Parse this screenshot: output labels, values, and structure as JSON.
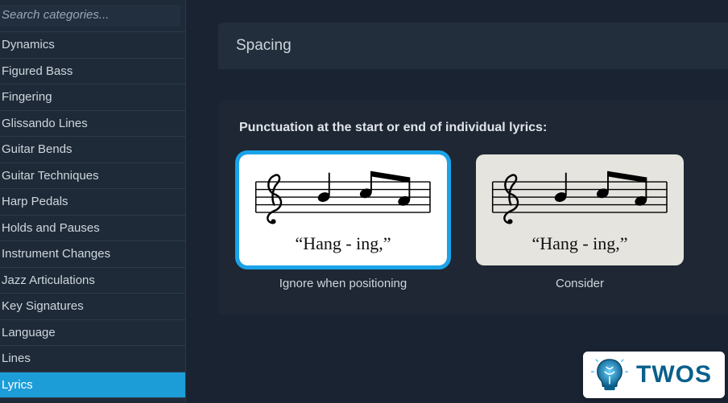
{
  "sidebar": {
    "search_placeholder": "Search categories...",
    "items": [
      {
        "label": "Dynamics",
        "selected": false
      },
      {
        "label": "Figured Bass",
        "selected": false
      },
      {
        "label": "Fingering",
        "selected": false
      },
      {
        "label": "Glissando Lines",
        "selected": false
      },
      {
        "label": "Guitar Bends",
        "selected": false
      },
      {
        "label": "Guitar Techniques",
        "selected": false
      },
      {
        "label": "Harp Pedals",
        "selected": false
      },
      {
        "label": "Holds and Pauses",
        "selected": false
      },
      {
        "label": "Instrument Changes",
        "selected": false
      },
      {
        "label": "Jazz Articulations",
        "selected": false
      },
      {
        "label": "Key Signatures",
        "selected": false
      },
      {
        "label": "Language",
        "selected": false
      },
      {
        "label": "Lines",
        "selected": false
      },
      {
        "label": "Lyrics",
        "selected": true
      }
    ]
  },
  "main": {
    "section_title": "Spacing",
    "setting_label": "Punctuation at the start or end of individual lyrics:",
    "options": [
      {
        "selected": true,
        "caption": "Ignore when positioning",
        "lyric": "“Hang - ing,”"
      },
      {
        "selected": false,
        "caption": "Consider",
        "lyric": "“Hang - ing,”"
      }
    ]
  },
  "badge": {
    "text": "TWOS"
  }
}
